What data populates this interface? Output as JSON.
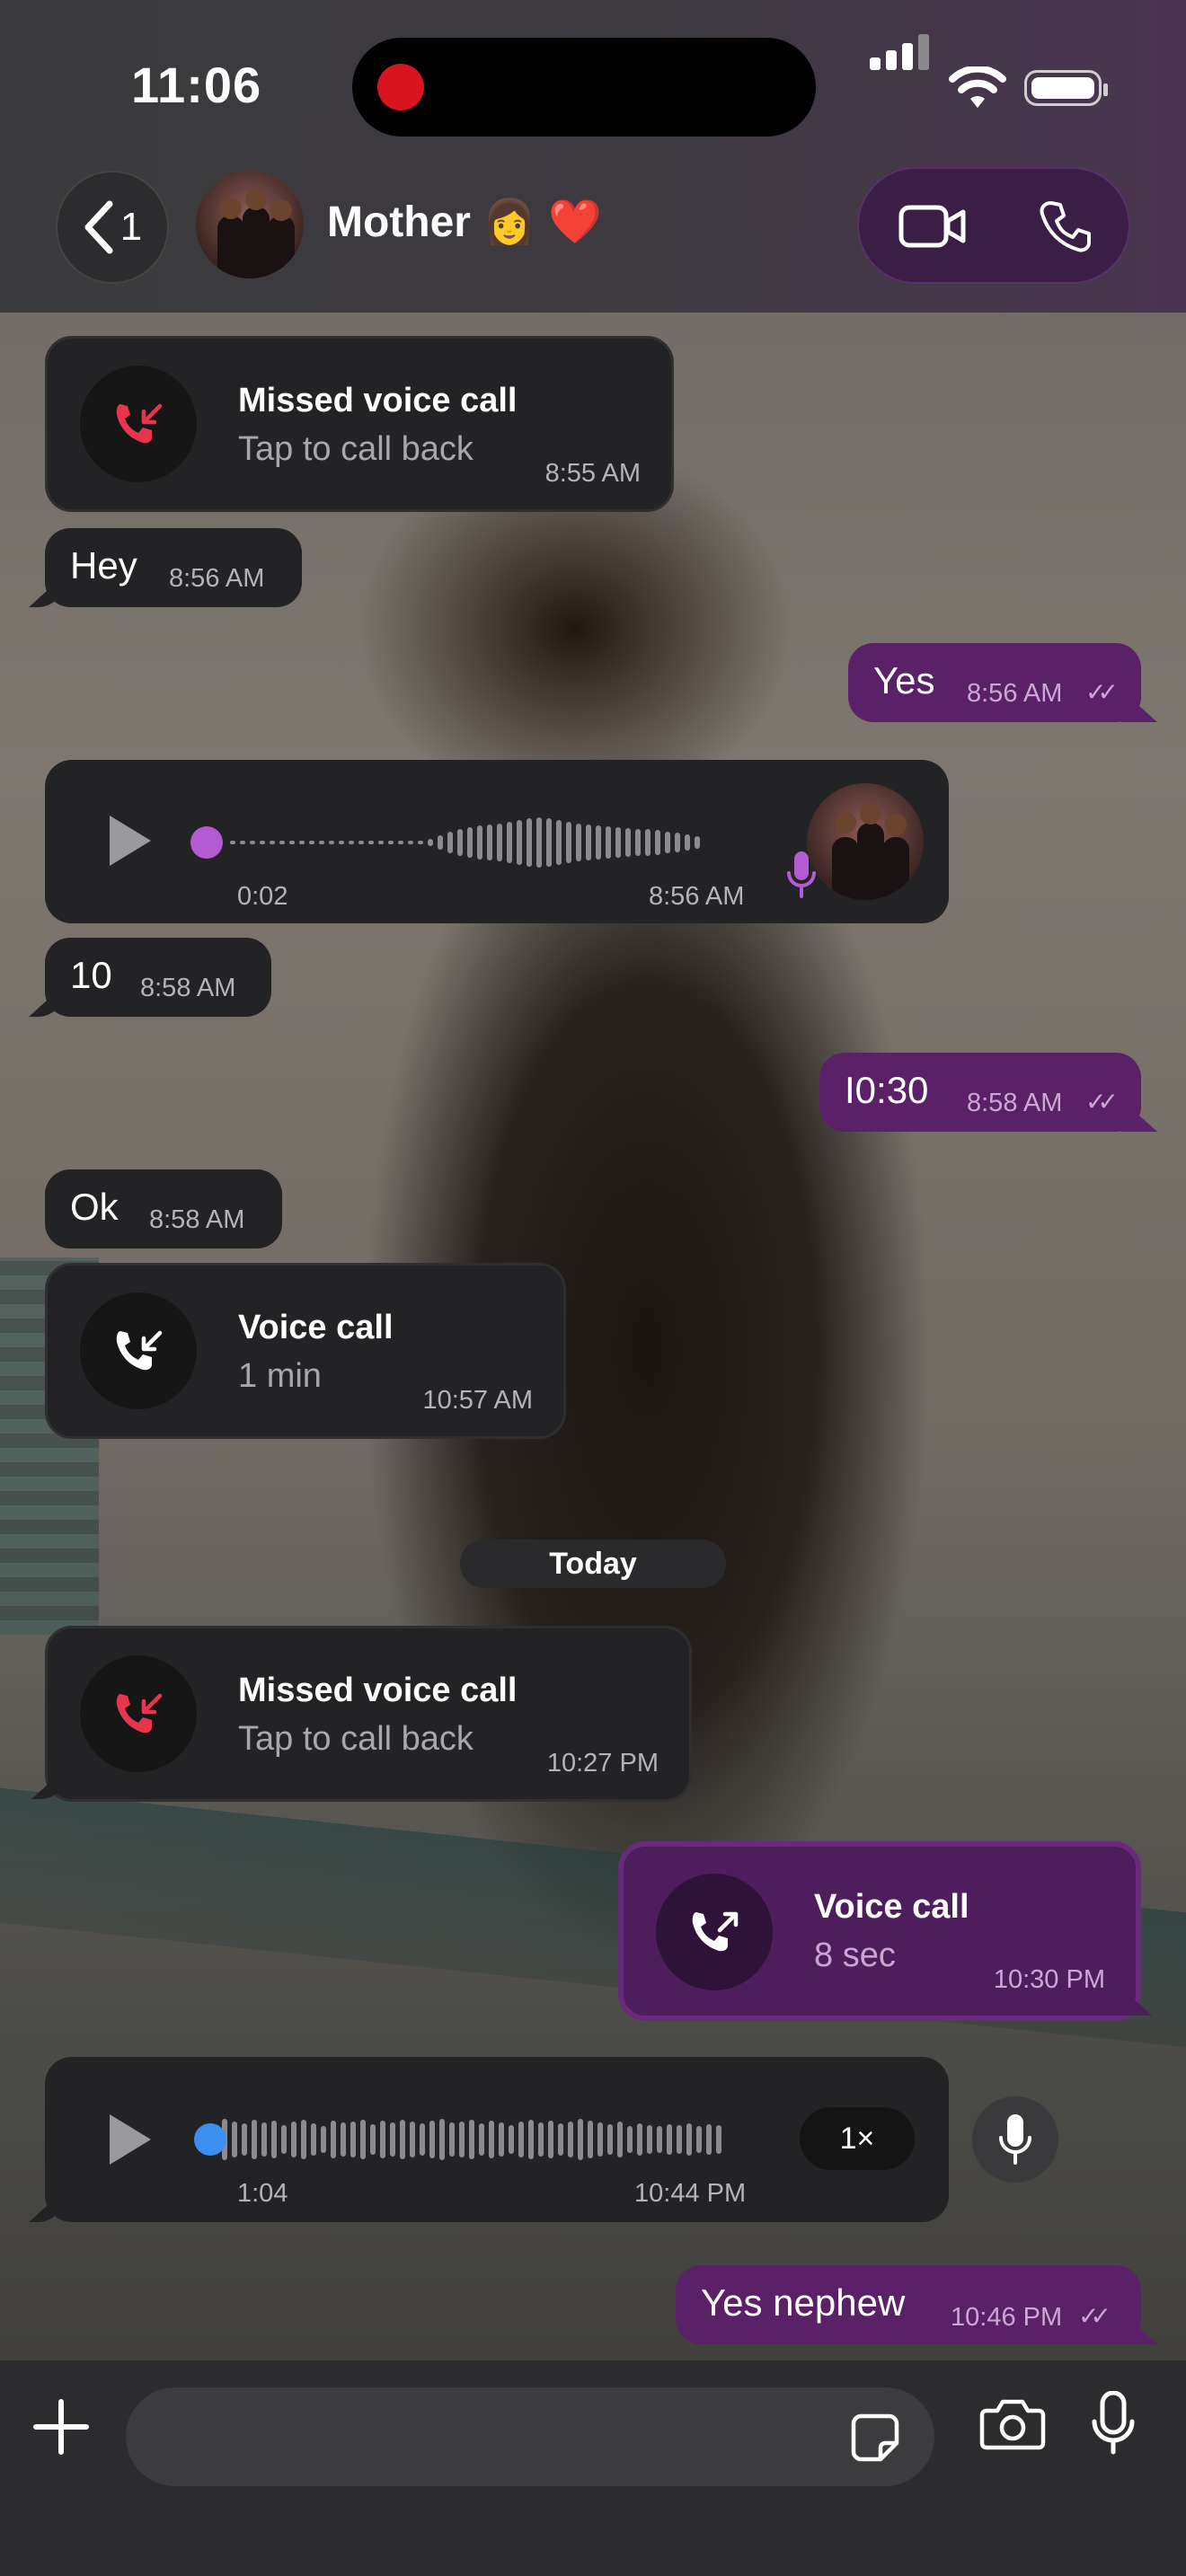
{
  "status": {
    "time": "11:06"
  },
  "header": {
    "back_count": "1",
    "contact_name": "Mother 👩 ❤️"
  },
  "messages": {
    "missed1": {
      "title": "Missed voice call",
      "sub": "Tap to call back",
      "time": "8:55 AM"
    },
    "hey": {
      "text": "Hey",
      "time": "8:56 AM"
    },
    "yes": {
      "text": "Yes",
      "time": "8:56 AM"
    },
    "voice1": {
      "duration": "0:02",
      "time": "8:56 AM"
    },
    "ten": {
      "text": "10",
      "time": "8:58 AM"
    },
    "ten30": {
      "text": "I0:30",
      "time": "8:58 AM"
    },
    "ok": {
      "text": "Ok",
      "time": "8:58 AM"
    },
    "call1": {
      "title": "Voice call",
      "sub": "1 min",
      "time": "10:57 AM"
    },
    "date_separator": "Today",
    "missed2": {
      "title": "Missed voice call",
      "sub": "Tap to call back",
      "time": "10:27 PM"
    },
    "call2": {
      "title": "Voice call",
      "sub": "8 sec",
      "time": "10:30 PM"
    },
    "voice2": {
      "duration": "1:04",
      "time": "10:44 PM",
      "speed": "1×"
    },
    "yes_nephew": {
      "text": "Yes nephew",
      "time": "10:46 PM"
    }
  },
  "colors": {
    "outgoing_bubble": "#5a2169",
    "incoming_bubble": "#232325",
    "missed_call_icon": "#e8354b",
    "voice_knob_1": "#b45ad2",
    "voice_knob_2": "#3b8ff0"
  },
  "icons": [
    "chevron-left-icon",
    "video-camera-icon",
    "phone-icon",
    "missed-call-icon",
    "incoming-call-icon",
    "outgoing-call-icon",
    "play-icon",
    "microphone-icon",
    "plus-icon",
    "sticker-icon",
    "camera-icon"
  ]
}
